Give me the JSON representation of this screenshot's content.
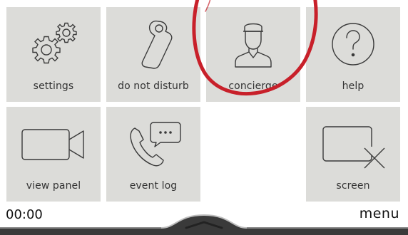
{
  "tiles": {
    "settings": {
      "label": "settings",
      "icon": "gears-icon"
    },
    "do_not_disturb": {
      "label": "do not disturb",
      "icon": "door-hanger-icon"
    },
    "concierge": {
      "label": "concierge",
      "icon": "concierge-person-icon"
    },
    "help": {
      "label": "help",
      "icon": "question-mark-icon"
    },
    "view_panel": {
      "label": "view panel",
      "icon": "video-camera-icon"
    },
    "event_log": {
      "label": "event log",
      "icon": "phone-message-icon"
    },
    "screen": {
      "label": "screen",
      "icon": "screen-off-icon"
    }
  },
  "status": {
    "time": "00:00",
    "menu_label": "menu"
  },
  "colors": {
    "tile_background": "#dcdcd9",
    "highlight_ring": "#c8202a",
    "text": "#333333"
  }
}
